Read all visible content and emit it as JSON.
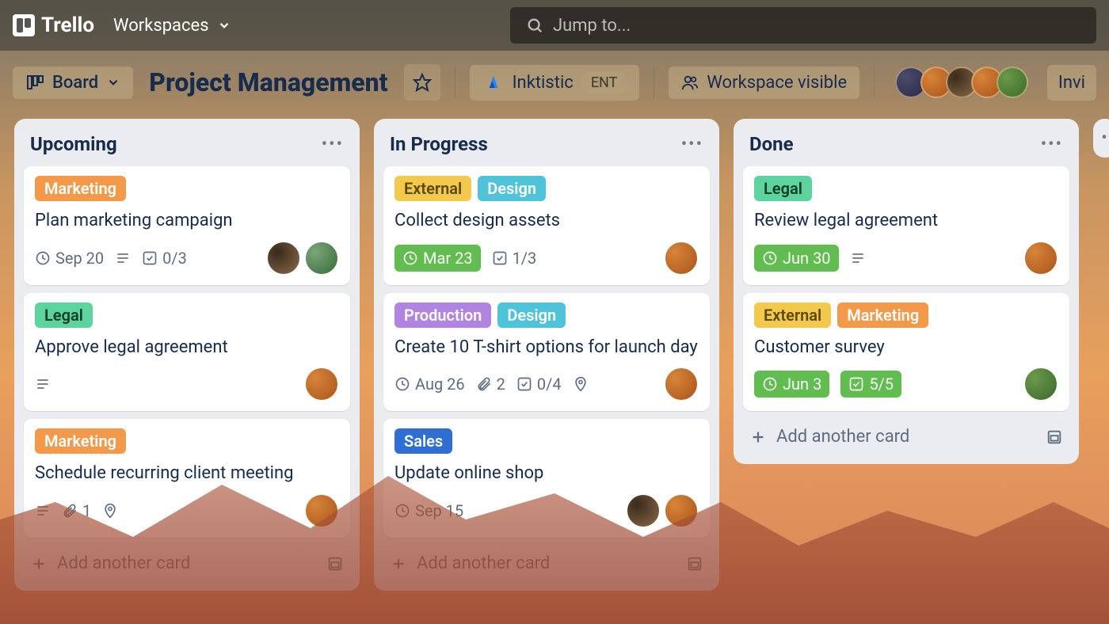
{
  "topnav": {
    "brand": "Trello",
    "workspaces_label": "Workspaces",
    "search_placeholder": "Jump to..."
  },
  "boardHeader": {
    "view_label": "Board",
    "title": "Project Management",
    "org_name": "Inktistic",
    "org_badge": "ENT",
    "visibility": "Workspace visible",
    "invite": "Invi"
  },
  "lists": [
    {
      "title": "Upcoming",
      "cards": [
        {
          "labels": [
            {
              "text": "Marketing",
              "cls": "marketing"
            }
          ],
          "title": "Plan marketing campaign",
          "date": "Sep 20",
          "dateGreen": false,
          "desc": true,
          "checklist": "0/3",
          "attach": null,
          "loc": false,
          "members": [
            "av1",
            "av2"
          ]
        },
        {
          "labels": [
            {
              "text": "Legal",
              "cls": "legal"
            }
          ],
          "title": "Approve legal agreement",
          "date": null,
          "dateGreen": false,
          "desc": true,
          "checklist": null,
          "attach": null,
          "loc": false,
          "members": [
            "av3"
          ]
        },
        {
          "labels": [
            {
              "text": "Marketing",
              "cls": "marketing"
            }
          ],
          "title": "Schedule recurring client meeting",
          "date": null,
          "dateGreen": false,
          "desc": true,
          "checklist": null,
          "attach": "1",
          "loc": true,
          "members": [
            "av3"
          ]
        }
      ],
      "add": "Add another card"
    },
    {
      "title": "In Progress",
      "cards": [
        {
          "labels": [
            {
              "text": "External",
              "cls": "external"
            },
            {
              "text": "Design",
              "cls": "design"
            }
          ],
          "title": "Collect design assets",
          "date": "Mar 23",
          "dateGreen": true,
          "desc": false,
          "checklist": "1/3",
          "attach": null,
          "loc": false,
          "members": [
            "av3"
          ]
        },
        {
          "labels": [
            {
              "text": "Production",
              "cls": "production"
            },
            {
              "text": "Design",
              "cls": "design"
            }
          ],
          "title": "Create 10 T-shirt options for launch day",
          "date": "Aug 26",
          "dateGreen": false,
          "desc": false,
          "checklist": "0/4",
          "attach": "2",
          "loc": true,
          "members": [
            "av3"
          ]
        },
        {
          "labels": [
            {
              "text": "Sales",
              "cls": "sales"
            }
          ],
          "title": "Update online shop",
          "date": "Sep 15",
          "dateGreen": false,
          "desc": false,
          "checklist": null,
          "attach": null,
          "loc": false,
          "members": [
            "av1",
            "av3"
          ]
        }
      ],
      "add": "Add another card"
    },
    {
      "title": "Done",
      "cards": [
        {
          "labels": [
            {
              "text": "Legal",
              "cls": "legal"
            }
          ],
          "title": "Review legal agreement",
          "date": "Jun 30",
          "dateGreen": true,
          "desc": true,
          "checklist": null,
          "attach": null,
          "loc": false,
          "members": [
            "av3"
          ]
        },
        {
          "labels": [
            {
              "text": "External",
              "cls": "external"
            },
            {
              "text": "Marketing",
              "cls": "marketing"
            }
          ],
          "title": "Customer survey",
          "date": "Jun 3",
          "dateGreen": true,
          "desc": false,
          "checklist": "5/5",
          "checklistGreen": true,
          "attach": null,
          "loc": false,
          "members": [
            "av5"
          ]
        }
      ],
      "add": "Add another card"
    }
  ]
}
